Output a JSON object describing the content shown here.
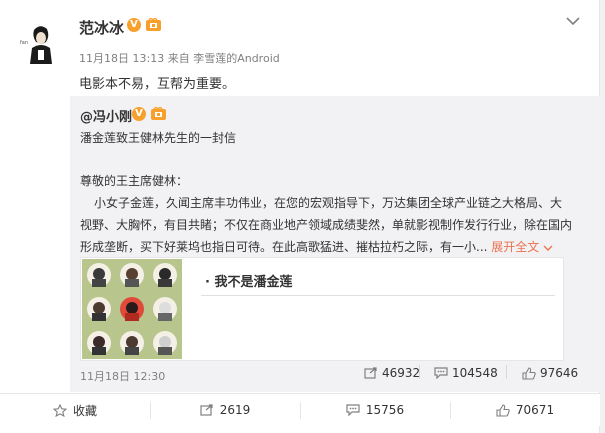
{
  "post": {
    "username": "范冰冰",
    "verified_mark": "V",
    "time": "11月18日 13:13",
    "source_prefix": "来自",
    "source": "李雪莲的Android",
    "text": "电影本不易，互帮为重要。"
  },
  "repost": {
    "author": "@冯小刚",
    "verified_mark": "V",
    "line1": "潘金莲致王健林先生的一封信",
    "line2": "尊敬的王主席健林：",
    "line3": "小女子金莲，久闻主席丰功伟业，在您的宏观指导下，万达集团全球产业链之大格局、大",
    "line4": "视野、大胸怀，有目共睹；不仅在商业地产领域成绩斐然，单就影视制作发行行业，除在国内",
    "line5": "形成垄断，买下好莱坞也指日可待。在此高歌猛进、摧枯拉朽之际，有一小...",
    "expand_label": "展开全文",
    "card_title": "· 我不是潘金莲",
    "time": "11月18日 12:30",
    "forward_count": "46932",
    "comment_count": "104548",
    "like_count": "97646"
  },
  "footer": {
    "favorite_label": "收藏",
    "forward_count": "2619",
    "comment_count": "15756",
    "like_count": "70671"
  },
  "colors": {
    "link_orange": "#eb7350",
    "badge_orange": "#f7a02b",
    "repost_bg": "#f2f2f5",
    "meta_gray": "#808080"
  },
  "icons": [
    "avatar",
    "verified-v-icon",
    "member-badge-icon",
    "chevron-down-icon",
    "expand-chevron-icon",
    "forward-icon",
    "comment-icon",
    "like-icon",
    "favorite-star-icon"
  ]
}
